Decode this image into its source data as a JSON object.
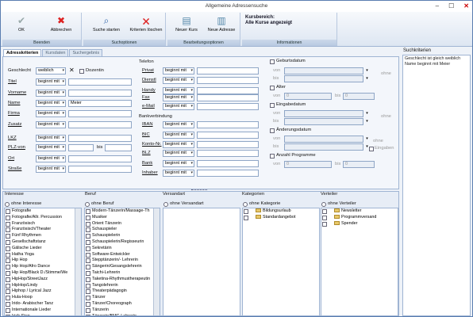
{
  "window": {
    "title": "Allgemeine Adressensuche"
  },
  "ribbon": {
    "ok": "OK",
    "abbrechen": "Abbrechen",
    "beenden": "Beenden",
    "suche_starten": "Suche starten",
    "kriterien_loeschen": "Kriterien löschen",
    "suchoptionen": "Suchoptionen",
    "neuer_kurs": "Neuer Kurs",
    "neue_adresse": "Neue Adresse",
    "bearbeitungsoptionen": "Bearbeitungsoptionen",
    "kursbereich": "Kursbereich:",
    "alle_kurse": "Alle Kurse angezeigt",
    "informationen": "Informationen"
  },
  "tabs": [
    "Adresskriterien",
    "Kursdaten",
    "Suchergebnis"
  ],
  "left_fields": {
    "geschlecht_label": "Geschlecht",
    "geschlecht_value": "weiblich",
    "dozentin": "Dozentin",
    "titel": "Titel",
    "vorname": "Vorname",
    "name": "Name",
    "firma": "Firma",
    "zusatz": "Zusatz",
    "lkz": "LKZ",
    "plz_von": "PLZ-von",
    "bis": "bis",
    "ort": "Ort",
    "strasse": "Straße",
    "op": "beginnt mit",
    "name_value": "Meier"
  },
  "telefon": {
    "head": "Telefon",
    "privat": "Privat",
    "dienstl": "Dienstl",
    "handy": "Handy",
    "fax": "Fax",
    "email": "e-Mail"
  },
  "bank": {
    "head": "Bankverbindung",
    "iban": "IBAN",
    "bic": "BIC",
    "konto": "Konto-Nr.",
    "blz": "BLZ",
    "bank": "Bank",
    "inhaber": "Inhaber"
  },
  "right": {
    "geburtsdatum": "Geburtsdatum",
    "von": "von",
    "bis": "bis",
    "ohne": "ohne",
    "alter": "Alter",
    "alter_von": "0",
    "alter_bis": "0",
    "eingabedatum": "Eingabedatum",
    "aenderungsdatum": "Änderungsdatum",
    "eingaben": "Eingaben",
    "anzahl": "Anzahl Programme",
    "anz_von": "0",
    "anz_bis": "0"
  },
  "lists": {
    "interesse": {
      "head": "Interesse",
      "ohne": "ohne Interesse",
      "items": [
        "Fotografie",
        "Fotografie/Allr. Percussion",
        "Französisch",
        "Französisch/Theater",
        "Fünf Rhythmen",
        "Gesellschaftstanz",
        "Gälische Lieder",
        "Hatha Yoga",
        "Hip Hop",
        "Hip Hop/Afro Dance",
        "Hip Hop/Black D./Stimme/We",
        "HipHop/StreetJazz",
        "HipHop/Lindy",
        "Hiphop / Lyrical Jazz",
        "Hula-Hoop",
        "Irido- Arabischer Tanz",
        "Internationale Lieder",
        "Irish Step"
      ]
    },
    "beruf": {
      "head": "Beruf",
      "ohne": "ohne Beruf",
      "items": [
        "Modern-Tänzerin/Massage-Th",
        "Musiker",
        "Orient Tänzerin",
        "Schauspieler",
        "Schauspielerin",
        "Schauspielerin/Regisseurin",
        "Sekretärin",
        "Software-Entwickler",
        "Stepptänzerin/- Lehrerin",
        "Sängerin/Gesangslehrerin",
        "Taichi-Lehrerin",
        "Taketina-Rhythmustherapeutin",
        "Tangolehrerin",
        "Theaterpädagogin",
        "Tänzer",
        "Tänzer/Choreograph",
        "Tänzerin",
        "Tänzerin/BMC-Lehrerin"
      ]
    },
    "versandart": {
      "head": "Versandart",
      "ohne": "ohne Versandart"
    },
    "kategorien": {
      "head": "Kategorien",
      "ohne": "ohne Kategorie",
      "items": [
        "Bildungsurlaub",
        "Standardangebot"
      ]
    },
    "verteiler": {
      "head": "Verteiler",
      "ohne": "ohne Verteiler",
      "items": [
        "Newsletter",
        "Programmversand",
        "Spender"
      ]
    }
  },
  "suchkriterien": {
    "head": "Suchkriterien",
    "lines": [
      "Geschlecht ist gleich weiblich",
      "Name beginnt mit Meier"
    ]
  }
}
